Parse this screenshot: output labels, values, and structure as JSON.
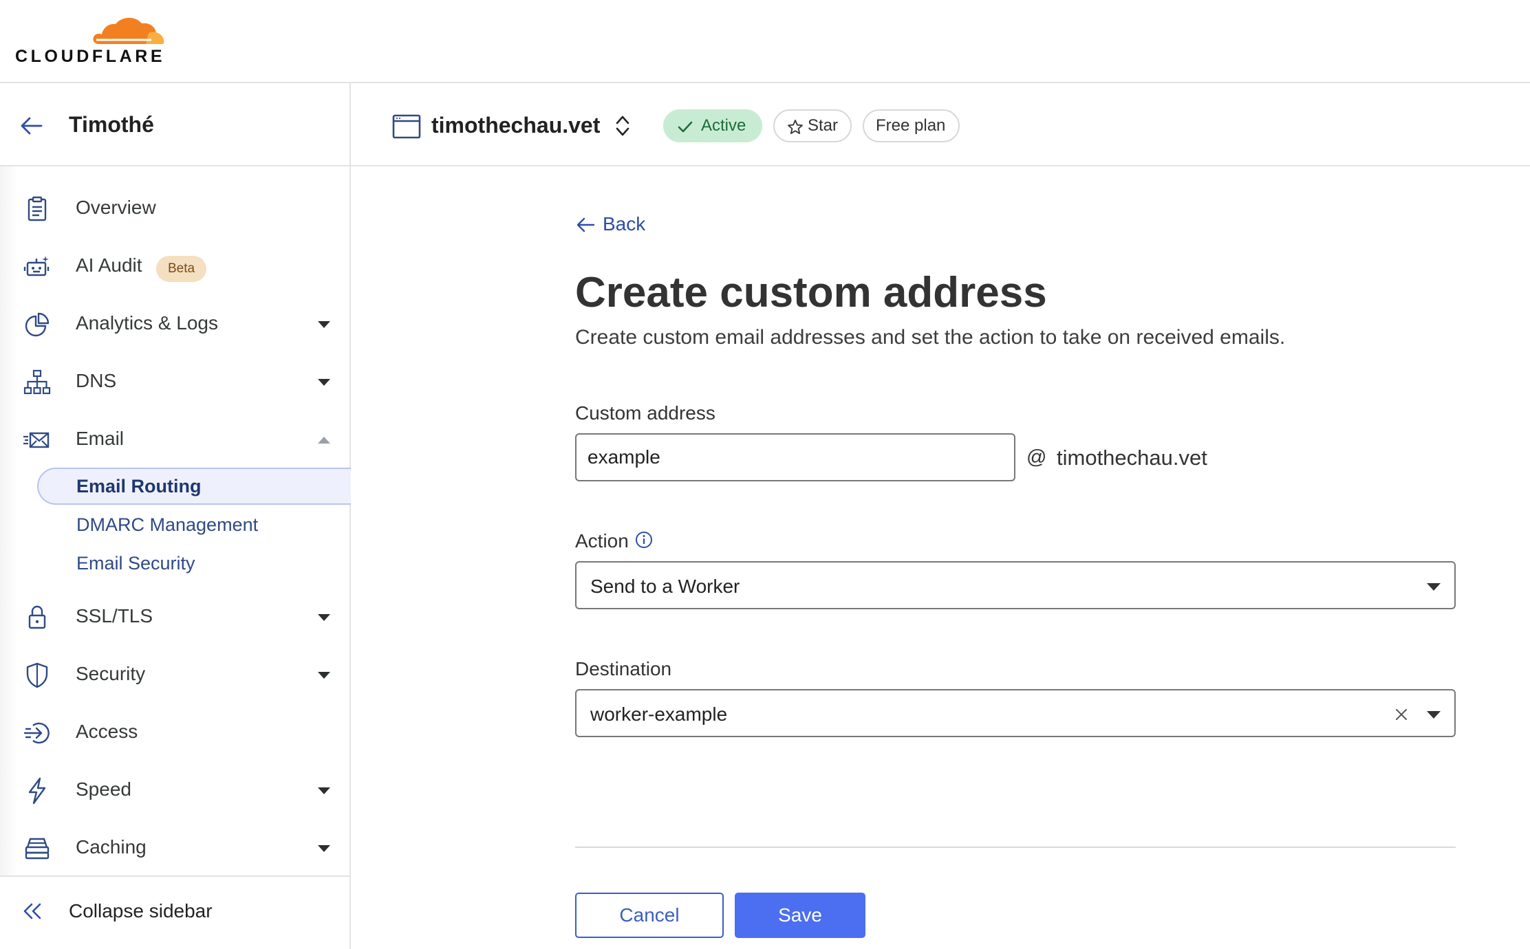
{
  "brand": {
    "name": "CLOUDFLARE",
    "orange": "#f38020",
    "orange_light": "#faae40"
  },
  "account": {
    "name": "Timothé"
  },
  "sidebar": {
    "items": [
      {
        "label": "Overview",
        "icon": "clipboard-icon",
        "has_caret": false
      },
      {
        "label": "AI Audit",
        "icon": "robot-icon",
        "badge": "Beta",
        "has_caret": false
      },
      {
        "label": "Analytics & Logs",
        "icon": "pie-chart-icon",
        "has_caret": true
      },
      {
        "label": "DNS",
        "icon": "network-icon",
        "has_caret": true
      },
      {
        "label": "Email",
        "icon": "email-icon",
        "has_caret": true,
        "expanded": true
      },
      {
        "label": "SSL/TLS",
        "icon": "lock-icon",
        "has_caret": true
      },
      {
        "label": "Security",
        "icon": "shield-icon",
        "has_caret": true
      },
      {
        "label": "Access",
        "icon": "login-icon",
        "has_caret": false
      },
      {
        "label": "Speed",
        "icon": "lightning-icon",
        "has_caret": true
      },
      {
        "label": "Caching",
        "icon": "server-icon",
        "has_caret": true
      }
    ],
    "email_subitems": [
      {
        "label": "Email Routing",
        "active": true
      },
      {
        "label": "DMARC Management",
        "active": false
      },
      {
        "label": "Email Security",
        "active": false
      }
    ],
    "collapse_label": "Collapse sidebar"
  },
  "zone": {
    "name": "timothechau.vet",
    "status": "Active",
    "star_label": "Star",
    "plan": "Free plan",
    "status_color": "#c8ecd3"
  },
  "form": {
    "back_label": "Back",
    "title": "Create custom address",
    "description": "Create custom email addresses and set the action to take on received emails.",
    "custom_address": {
      "label": "Custom address",
      "value": "example",
      "at": "@",
      "domain": "timothechau.vet"
    },
    "action": {
      "label": "Action",
      "value": "Send to a Worker"
    },
    "destination": {
      "label": "Destination",
      "value": "worker-example"
    },
    "cancel_label": "Cancel",
    "save_label": "Save",
    "primary_color": "#4c6ef0"
  }
}
